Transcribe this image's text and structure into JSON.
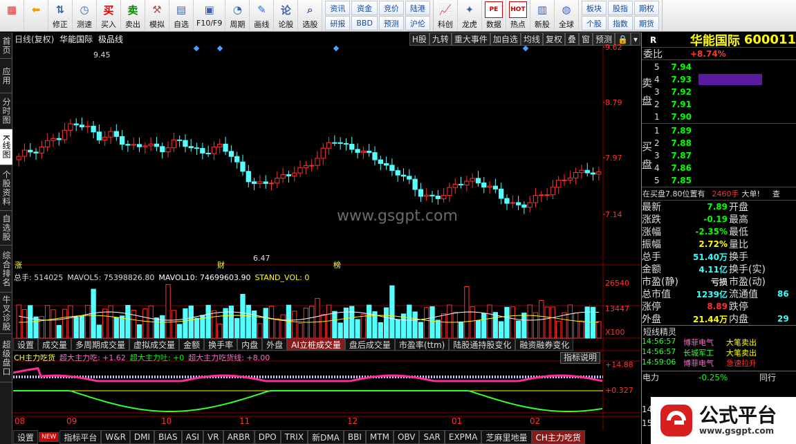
{
  "toolbar": {
    "buttons": [
      {
        "label": "",
        "icon": "grid-app-icon"
      },
      {
        "label": "",
        "icon": "back-arrow-icon"
      },
      {
        "label": "修正",
        "icon": "up-down-arrows-icon"
      },
      {
        "label": "测速",
        "icon": "speed-clock-icon"
      },
      {
        "label": "买入",
        "icon": "buy-icon",
        "glyph": "买"
      },
      {
        "label": "卖出",
        "icon": "sell-icon",
        "glyph": "卖"
      },
      {
        "label": "模拟",
        "icon": "hammer-icon"
      },
      {
        "label": "自选",
        "icon": "my-stocks-icon"
      },
      {
        "label": "F10/F9",
        "icon": "f10-icon"
      },
      {
        "label": "周期",
        "icon": "cycle-clock-icon"
      },
      {
        "label": "画线",
        "icon": "pen-icon"
      },
      {
        "label": "论股",
        "icon": "discuss-icon",
        "glyph": "论"
      },
      {
        "label": "选股",
        "icon": "stock-pick-icon"
      }
    ],
    "grid1": [
      "资讯",
      "资金",
      "竞价",
      "陆港",
      "研报",
      "BBD",
      "预测",
      "沪伦"
    ],
    "buttons2": [
      {
        "label": "科创",
        "icon": "sci-board-icon"
      },
      {
        "label": "龙虎",
        "icon": "dragon-tiger-icon"
      },
      {
        "label": "数据",
        "icon": "pe-data-icon",
        "glyph": "PE"
      },
      {
        "label": "热点",
        "icon": "hot-icon",
        "glyph": "HOT"
      },
      {
        "label": "新股",
        "icon": "new-stock-icon"
      },
      {
        "label": "全球",
        "icon": "globe-icon"
      }
    ],
    "grid2": [
      "板块",
      "股指",
      "期权",
      "个股",
      "指数",
      "期货"
    ]
  },
  "left_tabs": [
    "首页",
    "应用",
    "分时图",
    "K线图",
    "个股资料",
    "自选股",
    "综合排名",
    "牛叉诊股",
    "超级盘口"
  ],
  "chart": {
    "title": "日线(复权)",
    "stock_name": "华能国际",
    "variant": "极品线",
    "header_buttons": [
      "H股",
      "九转",
      "重大事件",
      "加自选",
      "均线",
      "复权",
      "叠",
      "窗",
      "预测",
      "🔒",
      "▾"
    ],
    "price_axis": [
      "9.62",
      "8.79",
      "7.97",
      "7.14"
    ],
    "high_label": "9.45",
    "low_label": "6.47",
    "markers": [
      "涨",
      "财",
      "榜"
    ],
    "watermark": "www.gsgpt.com",
    "volume_legend": {
      "total": "总手: 514025",
      "mavol5": "MAVOL5: 75398826.80",
      "mavol10": "MAVOL10: 74699603.90",
      "stand": "STAND_VOL: 0"
    },
    "volume_axis": [
      "26540",
      "13447",
      "X100"
    ],
    "indicator_tabs": [
      "设置",
      "成交量",
      "多周期成交量",
      "虚拟成交量",
      "金额",
      "换手率",
      "内盘",
      "外盘",
      "AI立桩成交量",
      "盘后成交量",
      "市盈率(ttm)",
      "陆股通持股变化",
      "融资融券变化"
    ],
    "ch_legend": {
      "name": "CH主力吃货",
      "a": "超大主力吃: +1.62",
      "b": "超大主力吐: +0",
      "c": "超大主力吃货线: +8.00"
    },
    "indicator_desc": "指标说明",
    "ch_axis": [
      "+14.88",
      "+0.327"
    ],
    "date_axis": [
      "08",
      "09",
      "10",
      "11",
      "12",
      "01",
      "02"
    ],
    "bottom_tabs": [
      "设置",
      "NEW",
      "指标平台",
      "W&R",
      "DMI",
      "BIAS",
      "ASI",
      "VR",
      "ARBR",
      "DPO",
      "TRIX",
      "新DMA",
      "BBI",
      "MTM",
      "OBV",
      "SAR",
      "EXPMA",
      "芝麻里地量",
      "CH主力吃货"
    ]
  },
  "quote": {
    "header_r": "R",
    "name": "华能国际",
    "code": "600011",
    "weibi_label": "委比",
    "weibi": "+8.74%",
    "sell_label": "卖盘",
    "buy_label": "买盘",
    "sell": [
      {
        "l": "5",
        "p": "7.94"
      },
      {
        "l": "4",
        "p": "7.93"
      },
      {
        "l": "3",
        "p": "7.92"
      },
      {
        "l": "2",
        "p": "7.91"
      },
      {
        "l": "1",
        "p": "7.90"
      }
    ],
    "buy": [
      {
        "l": "1",
        "p": "7.89"
      },
      {
        "l": "2",
        "p": "7.88"
      },
      {
        "l": "3",
        "p": "7.87"
      },
      {
        "l": "4",
        "p": "7.86"
      },
      {
        "l": "5",
        "p": "7.85"
      }
    ],
    "notice": "在买盘7.80位置有",
    "notice_qty": "2460手",
    "notice_tail": "大单!",
    "notice_extra": "查",
    "stats": [
      [
        "最新",
        "7.89",
        "开盘",
        ""
      ],
      [
        "涨跌",
        "-0.19",
        "最高",
        ""
      ],
      [
        "涨幅",
        "-2.35%",
        "最低",
        ""
      ],
      [
        "振幅",
        "2.72%",
        "量比",
        ""
      ],
      [
        "总手",
        "51.40万",
        "换手",
        ""
      ],
      [
        "金额",
        "4.11亿",
        "换手(实)",
        ""
      ],
      [
        "市盈(静)",
        "亏损",
        "市盈(动)",
        ""
      ],
      [
        "总市值",
        "1239亿",
        "流通值",
        "86"
      ],
      [
        "涨停",
        "8.89",
        "跌停",
        ""
      ],
      [
        "外盘",
        "21.44万",
        "内盘",
        "29"
      ]
    ],
    "ticks_title": "短线精灵",
    "ticks": [
      [
        "14:56:57",
        "博菲电气",
        "大笔卖出"
      ],
      [
        "14:56:57",
        "长城军工",
        "大笔卖出"
      ],
      [
        "14:59:06",
        "博菲电气",
        "急速拉升"
      ]
    ],
    "sector": [
      "电力",
      "-0.25%",
      "同行"
    ],
    "sector_extra": [
      "14",
      "15"
    ],
    "logo_text": "公式平台",
    "logo_sub": "www.gsgpt.com"
  }
}
